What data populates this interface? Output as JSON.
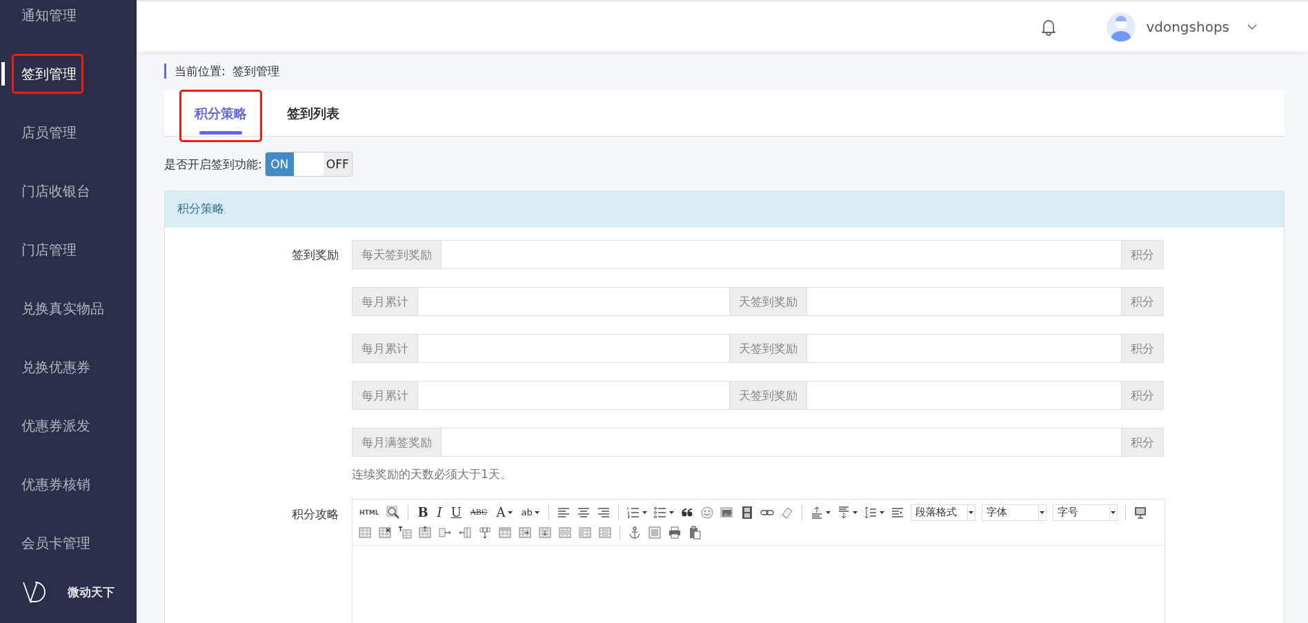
{
  "sidebar": {
    "items": [
      {
        "label": "通知管理",
        "selected": false,
        "annotated": false
      },
      {
        "label": "签到管理",
        "selected": true,
        "annotated": true
      },
      {
        "label": "店员管理",
        "selected": false,
        "annotated": false
      },
      {
        "label": "门店收银台",
        "selected": false,
        "annotated": false
      },
      {
        "label": "门店管理",
        "selected": false,
        "annotated": false
      },
      {
        "label": "兑换真实物品",
        "selected": false,
        "annotated": false
      },
      {
        "label": "兑换优惠券",
        "selected": false,
        "annotated": false
      },
      {
        "label": "优惠券派发",
        "selected": false,
        "annotated": false
      },
      {
        "label": "优惠券核销",
        "selected": false,
        "annotated": false
      },
      {
        "label": "会员卡管理",
        "selected": false,
        "annotated": false
      }
    ],
    "brand": "微动天下"
  },
  "header": {
    "username": "vdongshops"
  },
  "breadcrumb": {
    "label": "当前位置:",
    "current": "签到管理"
  },
  "tabs": [
    {
      "label": "积分策略",
      "selected": true,
      "annotated": true
    },
    {
      "label": "签到列表",
      "selected": false,
      "annotated": false
    }
  ],
  "signin_switch": {
    "label": "是否开启签到功能:",
    "on": true,
    "on_text": "ON",
    "off_text": "OFF"
  },
  "panel": {
    "title": "积分策略",
    "rows": [
      {
        "kind": "single",
        "label": "签到奖励",
        "prefix": "每天签到奖励",
        "suffix": "积分"
      },
      {
        "kind": "double",
        "prefix": "每月累计",
        "middle": "天签到奖励",
        "suffix": "积分"
      },
      {
        "kind": "double",
        "prefix": "每月累计",
        "middle": "天签到奖励",
        "suffix": "积分"
      },
      {
        "kind": "double",
        "prefix": "每月累计",
        "middle": "天签到奖励",
        "suffix": "积分"
      },
      {
        "kind": "single",
        "prefix": "每月满签奖励",
        "suffix": "积分"
      }
    ],
    "help": "连续奖励的天数必须大于1天。",
    "editor": {
      "label": "积分攻略",
      "text_buttons": [
        "HTML",
        "B",
        "I",
        "U",
        "ABC",
        "A",
        "ab"
      ],
      "selects": [
        "段落格式",
        "字体",
        "字号"
      ]
    }
  }
}
